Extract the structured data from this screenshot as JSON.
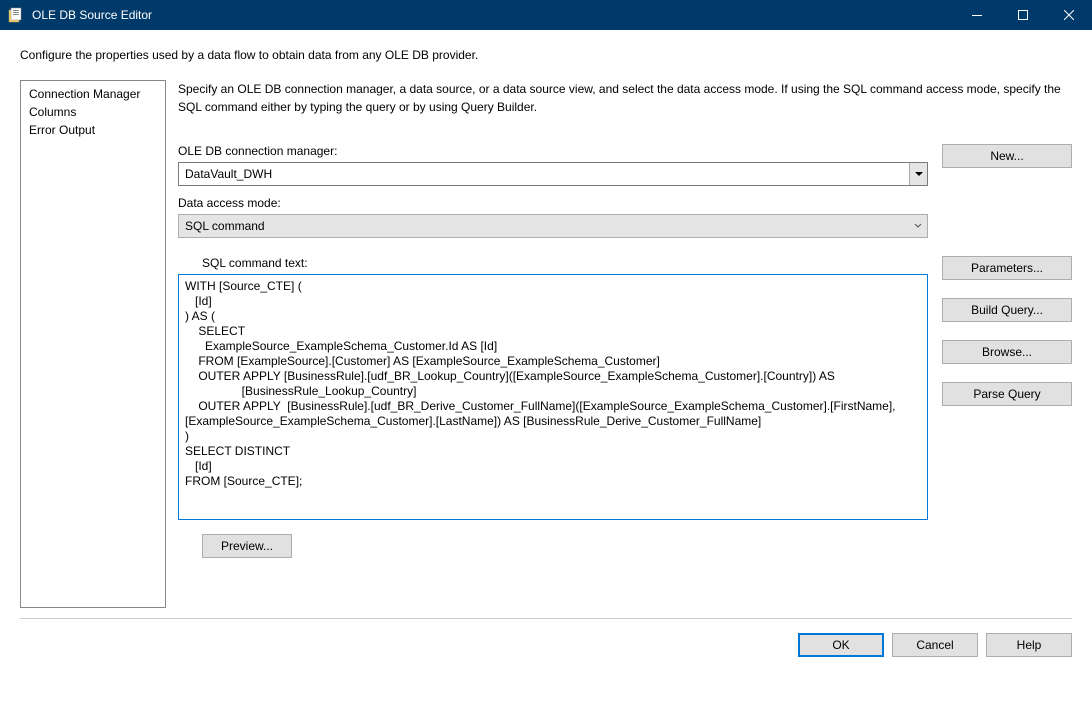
{
  "window": {
    "title": "OLE DB Source Editor"
  },
  "description": "Configure the properties used by a data flow to obtain data from any OLE DB provider.",
  "nav": {
    "items": [
      {
        "label": "Connection Manager"
      },
      {
        "label": "Columns"
      },
      {
        "label": "Error Output"
      }
    ]
  },
  "instructions": "Specify an OLE DB connection manager, a data source, or a data source view, and select the data access mode. If using the SQL command access mode, specify the SQL command either by typing the query or by using Query Builder.",
  "labels": {
    "connection_manager": "OLE DB connection manager:",
    "data_access_mode": "Data access mode:",
    "sql_command_text": "SQL command text:"
  },
  "values": {
    "connection_manager": "DataVault_DWH",
    "data_access_mode": "SQL command",
    "sql_command_text": "WITH [Source_CTE] (\n   [Id]\n) AS (\n    SELECT\n      ExampleSource_ExampleSchema_Customer.Id AS [Id]\n    FROM [ExampleSource].[Customer] AS [ExampleSource_ExampleSchema_Customer]\n    OUTER APPLY [BusinessRule].[udf_BR_Lookup_Country]([ExampleSource_ExampleSchema_Customer].[Country]) AS\n                 [BusinessRule_Lookup_Country]\n    OUTER APPLY  [BusinessRule].[udf_BR_Derive_Customer_FullName]([ExampleSource_ExampleSchema_Customer].[FirstName],\n[ExampleSource_ExampleSchema_Customer].[LastName]) AS [BusinessRule_Derive_Customer_FullName]\n)\nSELECT DISTINCT\n   [Id]\nFROM [Source_CTE];"
  },
  "buttons": {
    "new": "New...",
    "parameters": "Parameters...",
    "build_query": "Build Query...",
    "browse": "Browse...",
    "parse_query": "Parse Query",
    "preview": "Preview...",
    "ok": "OK",
    "cancel": "Cancel",
    "help": "Help"
  }
}
